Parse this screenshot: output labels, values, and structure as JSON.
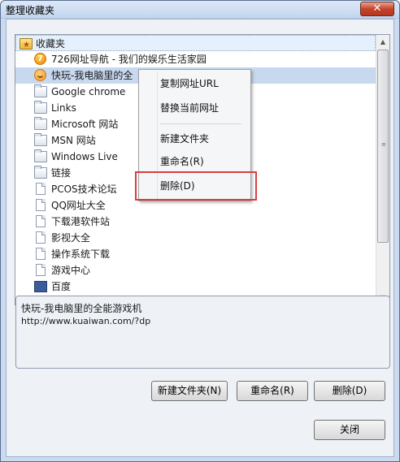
{
  "window": {
    "title": "整理收藏夹",
    "close_glyph": "✕"
  },
  "tree": {
    "root_label": "收藏夹",
    "items": [
      {
        "label": "726网址导航 - 我们的娱乐生活家园",
        "icon": "orange-7-icon",
        "icon_text": "7"
      },
      {
        "label": "快玩-我电脑里的全",
        "icon": "kuaiwan-smile-icon",
        "icon_text": ""
      },
      {
        "label": "Google chrome",
        "icon": "folder-icon",
        "icon_text": ""
      },
      {
        "label": "Links",
        "icon": "folder-icon",
        "icon_text": ""
      },
      {
        "label": "Microsoft 网站",
        "icon": "folder-icon",
        "icon_text": ""
      },
      {
        "label": "MSN 网站",
        "icon": "folder-icon",
        "icon_text": ""
      },
      {
        "label": "Windows Live",
        "icon": "folder-icon",
        "icon_text": ""
      },
      {
        "label": "链接",
        "icon": "folder-icon",
        "icon_text": ""
      },
      {
        "label": "PCOS技术论坛",
        "icon": "page-icon",
        "icon_text": ""
      },
      {
        "label": "QQ网址大全",
        "icon": "page-icon",
        "icon_text": ""
      },
      {
        "label": "下载港软件站",
        "icon": "page-icon",
        "icon_text": ""
      },
      {
        "label": "影视大全",
        "icon": "page-icon",
        "icon_text": ""
      },
      {
        "label": "操作系统下载",
        "icon": "page-icon",
        "icon_text": ""
      },
      {
        "label": "游戏中心",
        "icon": "page-icon",
        "icon_text": ""
      },
      {
        "label": "百度",
        "icon": "app-icon",
        "icon_text": ""
      }
    ],
    "selected_index": 1
  },
  "scrollbar": {
    "up_glyph": "▲",
    "down_glyph": "▼",
    "grip": "≡"
  },
  "context_menu": {
    "items": [
      {
        "label": "复制网址URL"
      },
      {
        "label": "替换当前网址"
      },
      {
        "label": "新建文件夹"
      },
      {
        "label": "重命名(R)"
      },
      {
        "label": "删除(D)"
      }
    ]
  },
  "detail": {
    "title": "快玩-我电脑里的全能游戏机",
    "url": "http://www.kuaiwan.com/?dp"
  },
  "buttons": {
    "new_folder": "新建文件夹(N)",
    "rename": "重命名(R)",
    "delete": "删除(D)",
    "close": "关闭"
  },
  "colors": {
    "highlight_border": "#d83e3e",
    "selection": "#c7d8ef"
  }
}
